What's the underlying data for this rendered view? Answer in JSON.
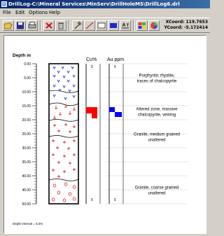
{
  "window": {
    "title": "DrillLog-C:\\Mineral Services\\MinServ\\DrillHoleMS\\DrillLog6.drl"
  },
  "menu": [
    "File",
    "Edit",
    "Options",
    "Help"
  ],
  "coords": {
    "x_label": "XCoord:",
    "x_value": "119.7653",
    "y_label": "YCoord:",
    "y_value": "-5.172414"
  },
  "toolbar_icons": [
    "open-folder-icon",
    "save-disk-icon",
    "printer-icon",
    "delete-x-icon",
    "trash-icon",
    "hammer-icon",
    "line-tool-icon",
    "rectangle-tool-icon",
    "fill-color-icon",
    "text-tool-icon",
    "palette-icon",
    "color-wheel-icon"
  ],
  "log": {
    "depth_header": "Depth m",
    "depths": [
      "0.00",
      "5.00",
      "10.00",
      "15.00",
      "20.00",
      "25.00",
      "30.00",
      "35.00",
      "40.00",
      "45.00",
      "50.00"
    ],
    "cu_header": "Cu%",
    "au_header": "Au ppm",
    "scale_tick": "5",
    "descriptions": [
      {
        "lines": [
          "Porphyritic rhyolite,",
          "traces of chalcopyrite"
        ],
        "depth": 5.5
      },
      {
        "lines": [
          "Altered zone, massive",
          "chalcopyrite, veining"
        ],
        "depth": 17.5
      },
      {
        "lines": [
          "Granite, medium grained",
          "unaltered"
        ],
        "depth": 26.5
      },
      {
        "lines": [
          "Granite, coarse grained",
          "unaltered"
        ],
        "depth": 45.5
      }
    ],
    "footer": "Depth Interval = 5.0m"
  },
  "colors": {
    "rhyolite_symbol": "#1f3fbf",
    "granite_symbol": "#e0281c",
    "assay_bar_cu": "#ff0000",
    "assay_bar_au": "#0000ff"
  }
}
